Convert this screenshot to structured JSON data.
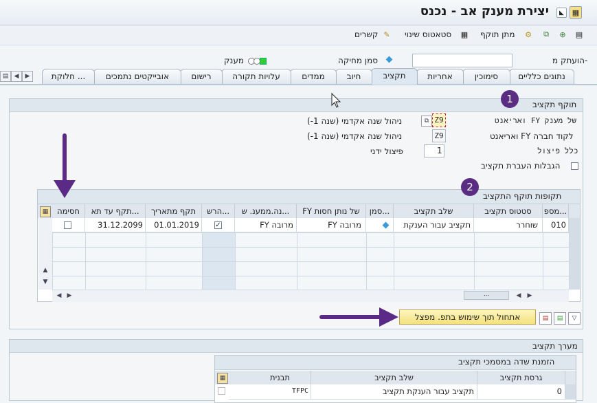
{
  "window": {
    "title": "יצירת מענק אב - נכנס"
  },
  "toolbar": {
    "relationships": "קשרים",
    "status_change": "סטאטוס שינוי",
    "validity": "מתן תוקף"
  },
  "header": {
    "copy_from_label": "הועתק מ-",
    "deletion_flag_label": "סמן מחיקה",
    "grant_label": "מענק"
  },
  "tabs": [
    "נתונים כלליים",
    "סימוכין",
    "אחריות",
    "תקציב",
    "חיוב",
    "ממדים",
    "עלויות תקורה",
    "רישום",
    "אובייקטים נתמכים",
    "חלוקת ..."
  ],
  "budget_validity": {
    "section_title": "תוקף תקציב",
    "fy_variant_grant_label": "ואריאנט FY של מענק",
    "fy_variant_grant_value": "Z9",
    "fy_variant_grant_desc": "ניהול שנה אקדמי (שנה 1-)",
    "fy_variant_cc_label": "ואריאנט FY לקוד חברה",
    "fy_variant_cc_value": "Z9",
    "fy_variant_cc_desc": "ניהול שנה אקדמי (שנה 1-)",
    "split_rule_label": "כלל פיצול",
    "split_rule_value": "1",
    "split_rule_desc": "פיצול ידני",
    "transfer_limits_label": "הגבלות העברת תקציב"
  },
  "periods": {
    "section_title": "תקופות תוקף התקציב",
    "columns": [
      "מספ...",
      "סטטוס תקציב",
      "שלב תקציב",
      "סמן...",
      "FY של נותן חסות",
      "נה.ממענ. ש...",
      "הרש...",
      "תקף מתאריך",
      "תקף עד תא...",
      "חסימה"
    ],
    "rows": [
      {
        "number": "010",
        "status": "שוחרר",
        "stage": "תקציב עבור הענקת",
        "sponsor_fy": "FY מרובה",
        "grant_fy": "FY מרובה",
        "valid_from": "01.01.2019",
        "valid_to": "31.12.2099"
      }
    ],
    "init_button": "אתחול תוך שימוש בתפ. מפצל"
  },
  "budget_structure": {
    "section_title": "מערך תקציב",
    "subsection_title": "הזמנת שדה במסמכי תקציב",
    "columns": [
      "גרסת תקציב",
      "שלב תקציב",
      "תבנית"
    ],
    "rows": [
      {
        "version": "0",
        "stage": "תקציב עבור הענקת תקציב",
        "template": "TFPC"
      }
    ]
  },
  "annotations": [
    "1",
    "2"
  ],
  "colors": {
    "arrow": "#5b2a86",
    "badge": "#5a2d83",
    "button": "#f3e27c"
  }
}
